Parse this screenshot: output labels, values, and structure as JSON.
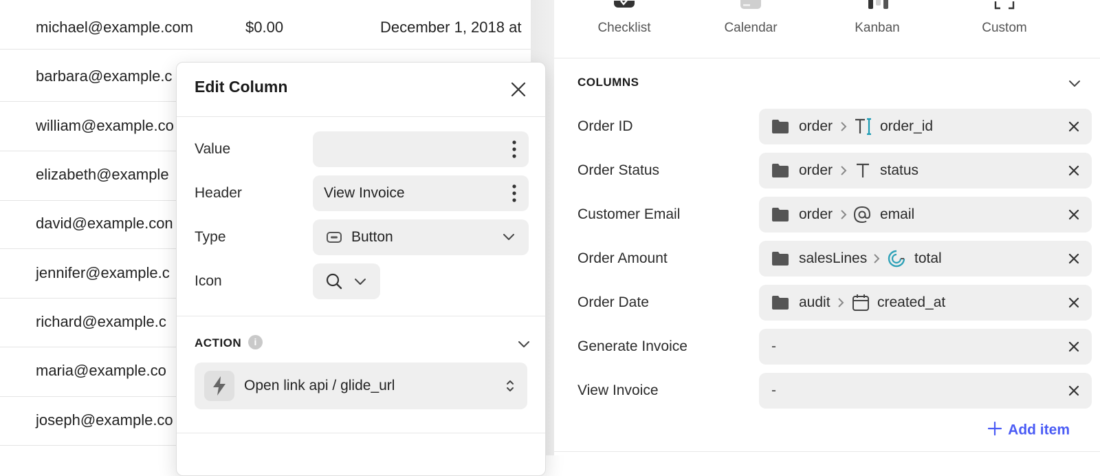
{
  "table": {
    "rows": [
      {
        "email": "michael@example.com",
        "amount": "$0.00",
        "date": "December 1, 2018 at"
      },
      {
        "email": "barbara@example.c",
        "amount": "",
        "date": ""
      },
      {
        "email": "william@example.co",
        "amount": "",
        "date": ""
      },
      {
        "email": "elizabeth@example",
        "amount": "",
        "date": ""
      },
      {
        "email": "david@example.con",
        "amount": "",
        "date": ""
      },
      {
        "email": "jennifer@example.c",
        "amount": "",
        "date": ""
      },
      {
        "email": "richard@example.c",
        "amount": "",
        "date": ""
      },
      {
        "email": "maria@example.co",
        "amount": "",
        "date": ""
      },
      {
        "email": "joseph@example.co",
        "amount": "",
        "date": ""
      }
    ]
  },
  "modal": {
    "title": "Edit Column",
    "close_icon": "close-icon",
    "value": {
      "label": "Value",
      "value": ""
    },
    "header": {
      "label": "Header",
      "value": "View Invoice"
    },
    "type": {
      "label": "Type",
      "value": "Button",
      "icon": "button-type-icon"
    },
    "icon": {
      "label": "Icon",
      "value_icon": "search-icon"
    },
    "action": {
      "section_title": "ACTION",
      "info_icon": "info-icon",
      "value": "Open link api / glide_url",
      "icon": "bolt-icon"
    }
  },
  "views": {
    "tabs": [
      {
        "label": "Checklist",
        "icon": "checklist-icon"
      },
      {
        "label": "Calendar",
        "icon": "calendar-icon"
      },
      {
        "label": "Kanban",
        "icon": "kanban-icon"
      },
      {
        "label": "Custom",
        "icon": "custom-icon"
      }
    ]
  },
  "columns": {
    "section_title": "COLUMNS",
    "items": [
      {
        "label": "Order ID",
        "path": [
          "order"
        ],
        "field": "order_id",
        "field_icon": "text-cursor-icon"
      },
      {
        "label": "Order Status",
        "path": [
          "order"
        ],
        "field": "status",
        "field_icon": "text-icon"
      },
      {
        "label": "Customer Email",
        "path": [
          "order"
        ],
        "field": "email",
        "field_icon": "at-icon"
      },
      {
        "label": "Order Amount",
        "path": [
          "salesLines"
        ],
        "field": "total",
        "field_icon": "rollup-icon"
      },
      {
        "label": "Order Date",
        "path": [
          "audit"
        ],
        "field": "created_at",
        "field_icon": "calendar-icon"
      },
      {
        "label": "Generate Invoice",
        "value": "-"
      },
      {
        "label": "View Invoice",
        "value": "-"
      }
    ],
    "add_item_label": "Add item"
  },
  "colors": {
    "accent": "#4a5bf5",
    "field_bg": "#efefef",
    "text_cursor_accent": "#1a9bb3",
    "rollup_accent": "#2fa2b8"
  }
}
